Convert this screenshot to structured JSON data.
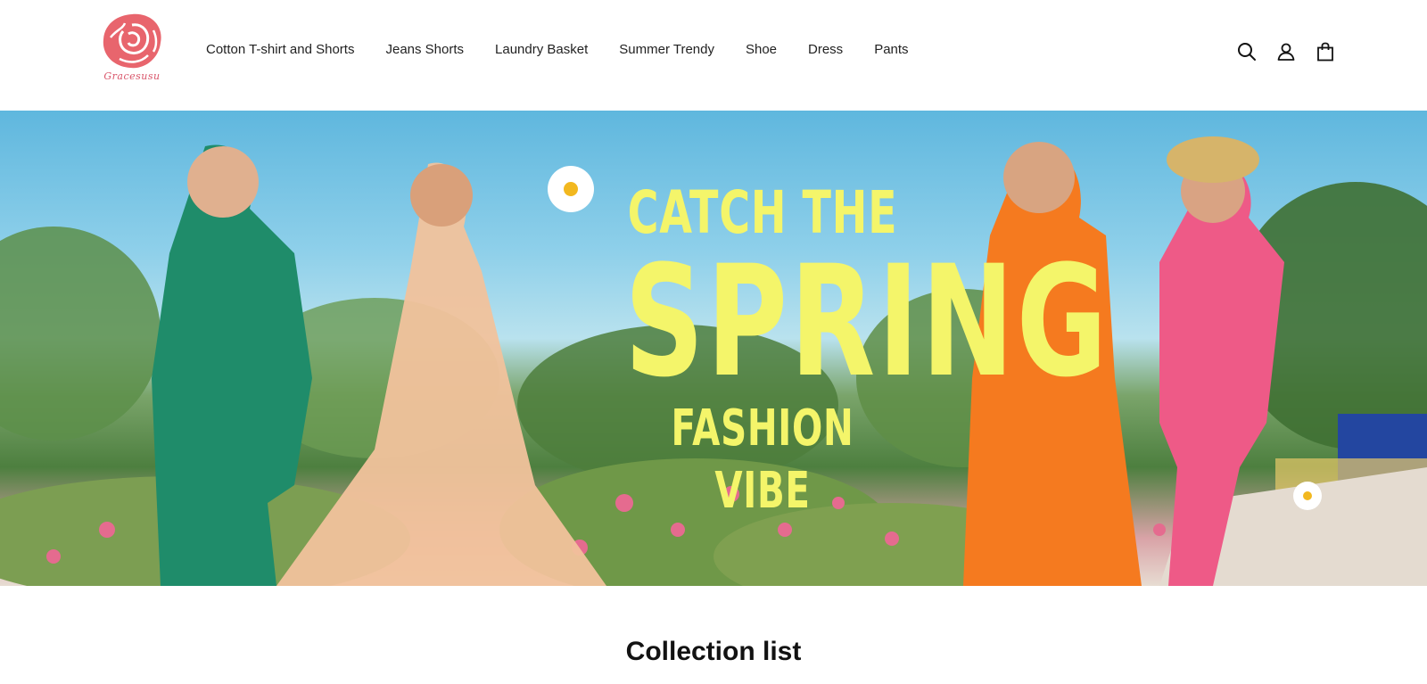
{
  "brand": {
    "logo_text": "Gracesusu",
    "logo_color": "#e8656d"
  },
  "nav": {
    "items": [
      {
        "label": "Cotton T-shirt and Shorts"
      },
      {
        "label": "Jeans Shorts"
      },
      {
        "label": "Laundry Basket"
      },
      {
        "label": "Summer Trendy"
      },
      {
        "label": "Shoe"
      },
      {
        "label": "Dress"
      },
      {
        "label": "Pants"
      }
    ]
  },
  "header_icons": [
    {
      "name": "search-icon"
    },
    {
      "name": "account-icon"
    },
    {
      "name": "cart-bag-icon"
    }
  ],
  "hero": {
    "line1": "CATCH THE",
    "line2": "SPRING",
    "line3": "FASHION VIBE",
    "text_color": "#f4f56a"
  },
  "sections": {
    "collection_title": "Collection list"
  }
}
